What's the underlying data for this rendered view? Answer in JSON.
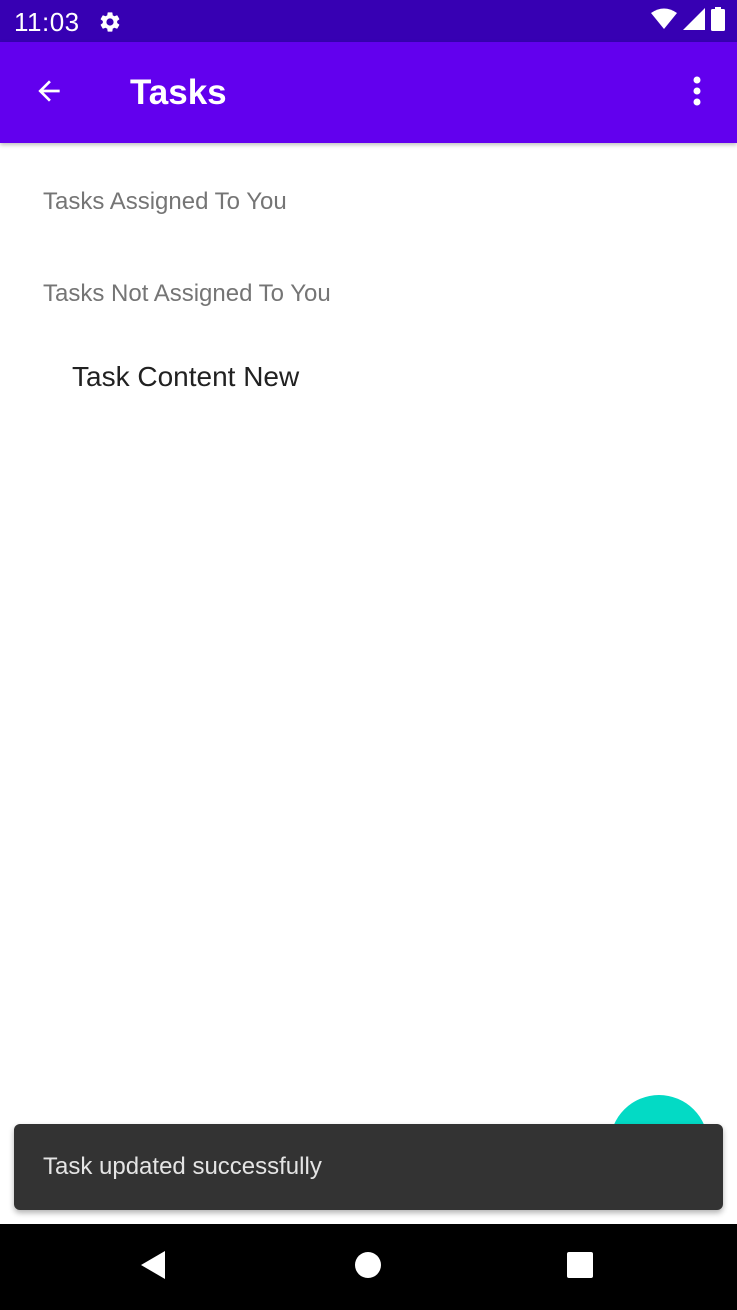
{
  "status_bar": {
    "time": "11:03",
    "icons": [
      "settings-gear-icon",
      "wifi-icon",
      "signal-icon",
      "battery-icon"
    ]
  },
  "app_bar": {
    "title": "Tasks",
    "back_icon": "arrow-back-icon",
    "menu_icon": "more-vert-icon",
    "color": "#6200ee"
  },
  "sections": [
    {
      "header": "Tasks Assigned To You",
      "items": []
    },
    {
      "header": "Tasks Not Assigned To You",
      "items": [
        "Task Content New"
      ]
    }
  ],
  "fab": {
    "color": "#03dac5"
  },
  "snackbar": {
    "message": "Task updated successfully"
  },
  "nav_bar": {
    "icons": [
      "nav-back-icon",
      "nav-home-icon",
      "nav-recents-icon"
    ]
  }
}
